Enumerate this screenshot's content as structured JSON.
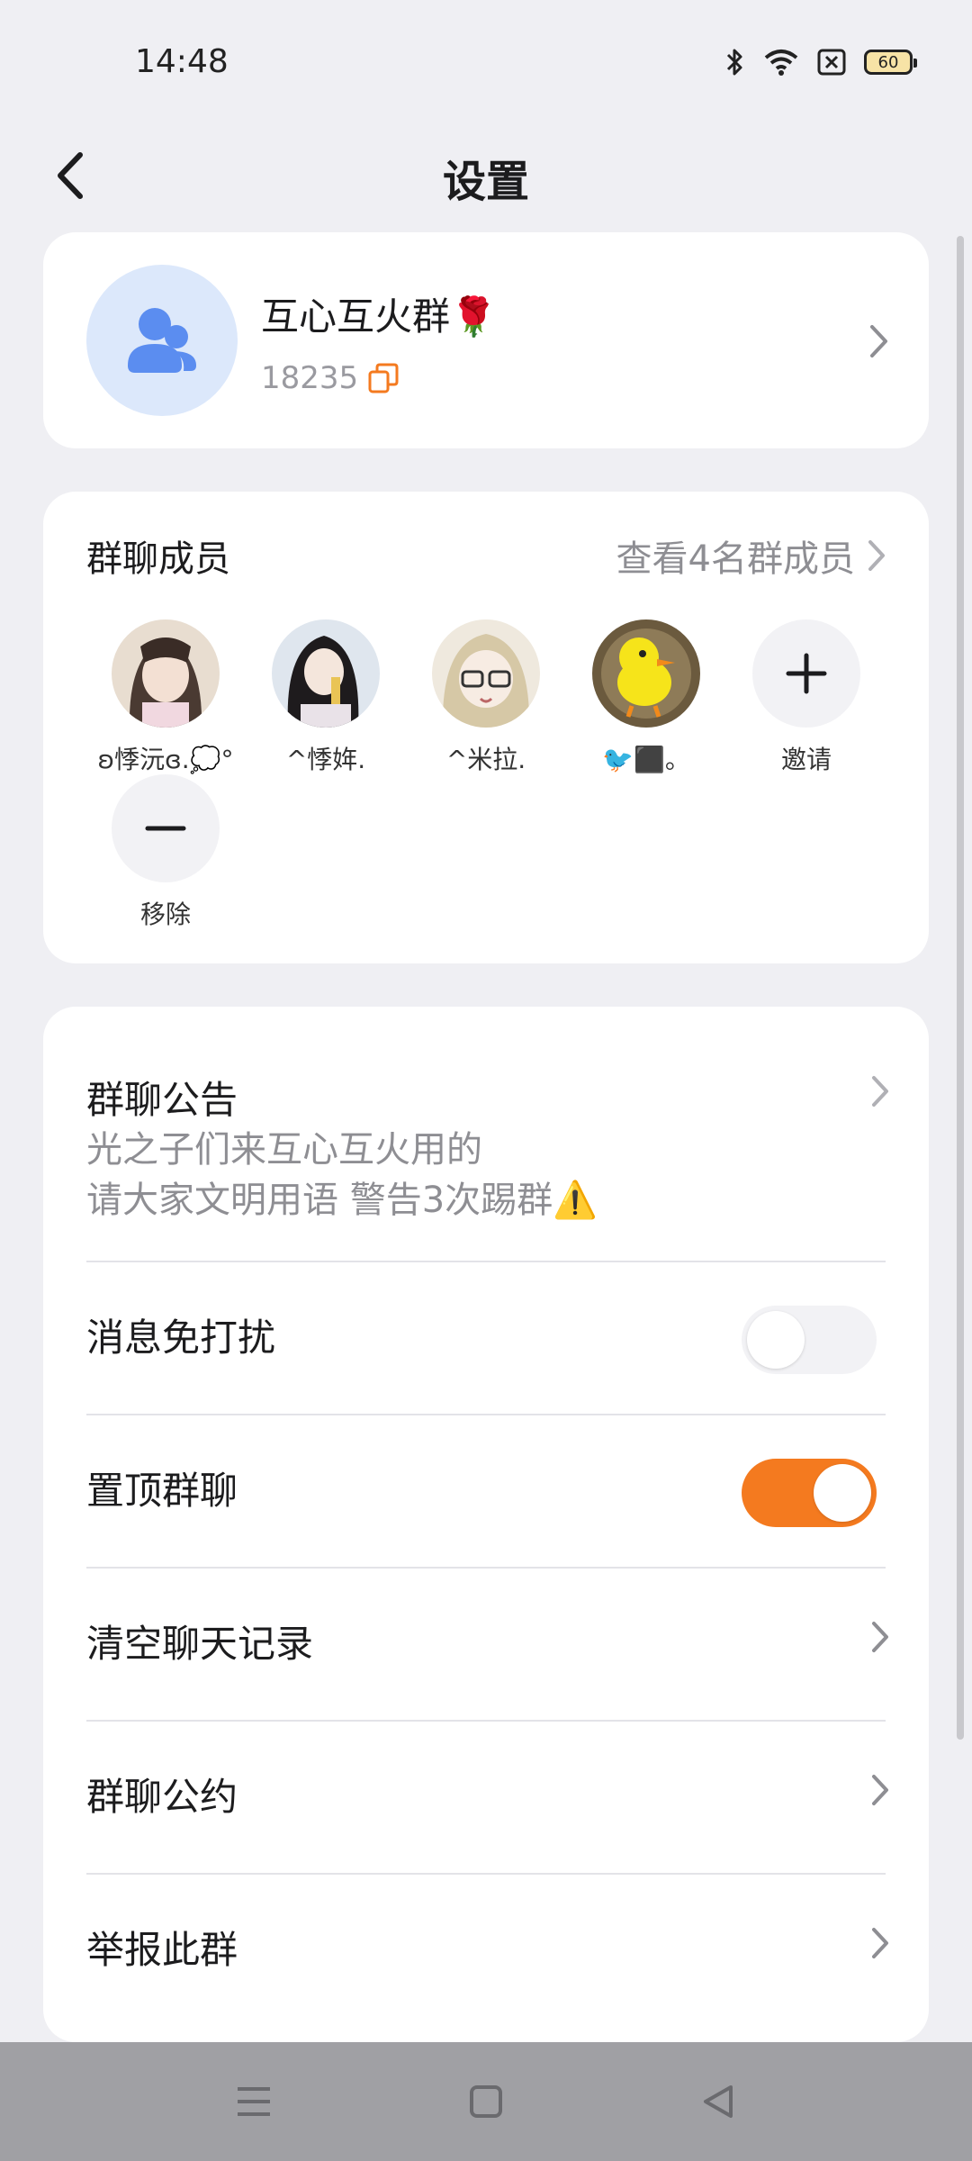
{
  "status_bar": {
    "time": "14:48",
    "battery": "60",
    "icons": [
      "bluetooth-icon",
      "wifi-icon",
      "sim-off-icon",
      "battery-icon"
    ]
  },
  "header": {
    "title": "设置",
    "back_icon": "back-arrow-icon"
  },
  "group": {
    "name": "互心互火群🌹",
    "id": "18235",
    "avatar_icon": "group-people-icon",
    "avatar_bg": "#dce8fb",
    "copy_icon_color": "#f47a1f"
  },
  "members": {
    "title": "群聊成员",
    "view_all": "查看4名群成员",
    "list": [
      {
        "name": "ʚ悸沅ɞ.💭°"
      },
      {
        "name": "^悸姩."
      },
      {
        "name": "^米拉."
      },
      {
        "name": "🐦⬛。"
      }
    ],
    "invite_label": "邀请",
    "remove_label": "移除"
  },
  "settings": {
    "announcement": {
      "label": "群聊公告",
      "line1": "光之子们来互心互火用的",
      "line2": "请大家文明用语 警告3次踢群⚠️"
    },
    "do_not_disturb": {
      "label": "消息免打扰",
      "on": false
    },
    "pin_chat": {
      "label": "置顶群聊",
      "on": true
    },
    "clear_history": {
      "label": "清空聊天记录"
    },
    "group_rules": {
      "label": "群聊公约"
    },
    "report": {
      "label": "举报此群"
    }
  },
  "colors": {
    "accent": "#f47a1f",
    "background": "#efeff3",
    "card": "#ffffff"
  },
  "nav_bar": {
    "icons": [
      "menu-icon",
      "home-square-icon",
      "back-triangle-icon"
    ]
  }
}
